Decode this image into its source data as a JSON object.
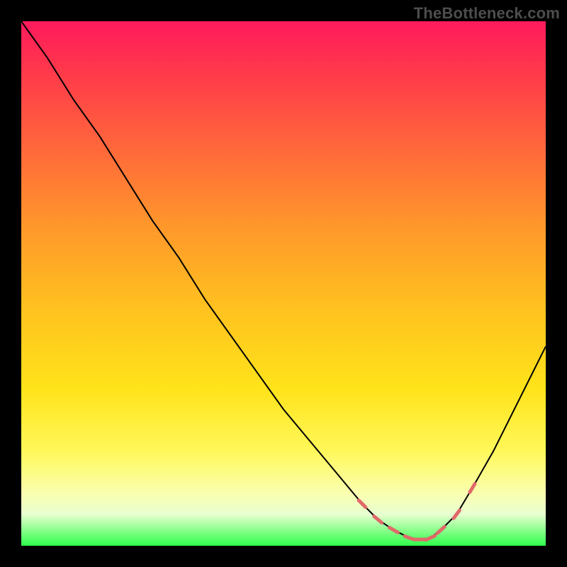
{
  "watermark": "TheBottleneck.com",
  "colors": {
    "gradient_top": "#ff1a5c",
    "gradient_mid1": "#ff6a3a",
    "gradient_mid2": "#ffe31a",
    "gradient_bottom": "#2eff4a",
    "curve": "#000000",
    "valley_marks": "#e06a6a",
    "frame": "#000000"
  },
  "chart_data": {
    "type": "line",
    "title": "",
    "xlabel": "",
    "ylabel": "",
    "xlim": [
      0,
      1
    ],
    "ylim": [
      0,
      1
    ],
    "note": "Axes have no tick labels in the source image; x and y are normalized 0–1 over the visible plot area. y=1 is top (red), y=0 is bottom (green). The plotted curve is a V-shape with rounded minimum near x≈0.76.",
    "series": [
      {
        "name": "curve",
        "x": [
          0.0,
          0.05,
          0.1,
          0.15,
          0.2,
          0.25,
          0.3,
          0.35,
          0.4,
          0.45,
          0.5,
          0.55,
          0.6,
          0.65,
          0.68,
          0.71,
          0.74,
          0.76,
          0.78,
          0.8,
          0.83,
          0.86,
          0.9,
          0.95,
          1.0
        ],
        "y": [
          1.0,
          0.93,
          0.85,
          0.78,
          0.7,
          0.62,
          0.55,
          0.47,
          0.4,
          0.33,
          0.26,
          0.2,
          0.14,
          0.08,
          0.05,
          0.03,
          0.015,
          0.012,
          0.015,
          0.03,
          0.06,
          0.11,
          0.18,
          0.28,
          0.38
        ]
      }
    ],
    "valley_markers": {
      "name": "valley-ticks",
      "x": [
        0.65,
        0.68,
        0.71,
        0.74,
        0.76,
        0.78,
        0.8,
        0.83,
        0.86
      ],
      "y": [
        0.08,
        0.05,
        0.03,
        0.015,
        0.012,
        0.015,
        0.03,
        0.06,
        0.11
      ],
      "style": "short pink dashes along the curve near the minimum"
    }
  }
}
